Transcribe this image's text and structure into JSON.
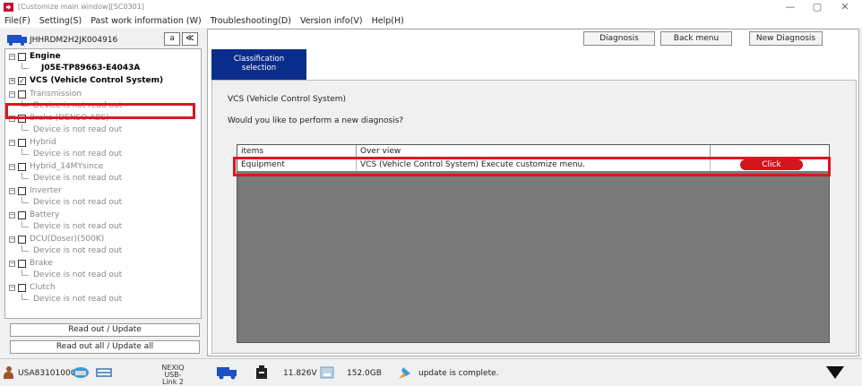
{
  "window": {
    "title": "[Customize main window][SC0301]",
    "controls": {
      "minimize": "—",
      "maximize": "▢",
      "close": "✕"
    }
  },
  "menu": [
    "File(F)",
    "Setting(S)",
    "Past work information (W)",
    "Troubleshooting(D)",
    "Version info(V)",
    "Help(H)"
  ],
  "left_panel": {
    "vin": "JHHRDM2H2JK004916",
    "btn_a": "a",
    "btn_collapse": "≪",
    "tree": [
      {
        "label": "Engine",
        "state": "bold",
        "child": "J05E-TP89663-E4043A",
        "child_state": "bold"
      },
      {
        "label": "VCS (Vehicle Control System)",
        "state": "bold",
        "checked": true
      },
      {
        "label": "Transmission",
        "state": "gray",
        "child": "Device is not read out"
      },
      {
        "label": "Brake (DENSO ABS)",
        "state": "normal",
        "child": "Device is not read out"
      },
      {
        "label": "Hybrid",
        "state": "normal",
        "child": "Device is not read out"
      },
      {
        "label": "Hybrid_14MYsince",
        "state": "normal",
        "child": "Device is not read out"
      },
      {
        "label": "Inverter",
        "state": "normal",
        "child": "Device is not read out"
      },
      {
        "label": "Battery",
        "state": "normal",
        "child": "Device is not read out"
      },
      {
        "label": "DCU(Doser)(500K)",
        "state": "normal",
        "child": "Device is not read out"
      },
      {
        "label": "Brake",
        "state": "normal",
        "child": "Device is not read out"
      },
      {
        "label": "Clutch",
        "state": "normal",
        "child": "Device is not read out"
      }
    ],
    "read_out_update": "Read out / Update",
    "read_out_all": "Read out all / Update all"
  },
  "right_panel": {
    "diagnosis": "Diagnosis",
    "back_menu": "Back menu",
    "new_diagnosis": "New Diagnosis",
    "tab_line1": "Classification",
    "tab_line2": "selection",
    "vcs_title": "VCS (Vehicle Control System)",
    "question": "Would you like to perform a new diagnosis?",
    "table": {
      "headers": {
        "items": "items",
        "overview": "Over view"
      },
      "row": {
        "item": "Equipment",
        "overview": "VCS (Vehicle Control System) Execute customize menu.",
        "action": "Click"
      }
    }
  },
  "status": {
    "user": "USA831010003",
    "device_line1": "NEXIQ USB-",
    "device_line2": "Link 2",
    "voltage": "11.826V",
    "disk": "152.0GB",
    "message": "update is complete."
  }
}
